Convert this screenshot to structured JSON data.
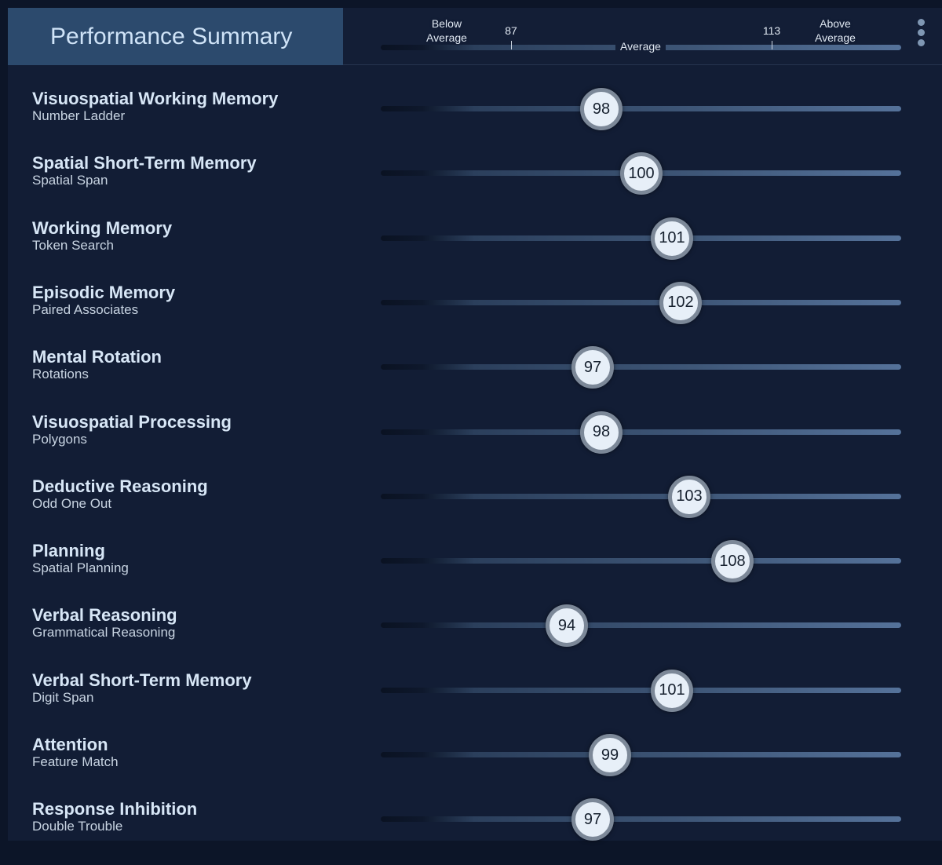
{
  "title": "Performance Summary",
  "scale": {
    "below": "Below\nAverage",
    "low_cut": "87",
    "average": "Average",
    "high_cut": "113",
    "above": "Above\nAverage"
  },
  "rows": [
    {
      "name": "Visuospatial Working Memory",
      "task": "Number Ladder",
      "score": "98"
    },
    {
      "name": "Spatial Short-Term Memory",
      "task": "Spatial Span",
      "score": "100"
    },
    {
      "name": "Working Memory",
      "task": "Token Search",
      "score": "101"
    },
    {
      "name": "Episodic Memory",
      "task": "Paired Associates",
      "score": "102"
    },
    {
      "name": "Mental Rotation",
      "task": "Rotations",
      "score": "97"
    },
    {
      "name": "Visuospatial Processing",
      "task": "Polygons",
      "score": "98"
    },
    {
      "name": "Deductive Reasoning",
      "task": "Odd One Out",
      "score": "103"
    },
    {
      "name": "Planning",
      "task": "Spatial Planning",
      "score": "108"
    },
    {
      "name": "Verbal Reasoning",
      "task": "Grammatical Reasoning",
      "score": "94"
    },
    {
      "name": "Verbal Short-Term Memory",
      "task": "Digit Span",
      "score": "101"
    },
    {
      "name": "Attention",
      "task": "Feature Match",
      "score": "99"
    },
    {
      "name": "Response Inhibition",
      "task": "Double Trouble",
      "score": "97"
    }
  ]
}
